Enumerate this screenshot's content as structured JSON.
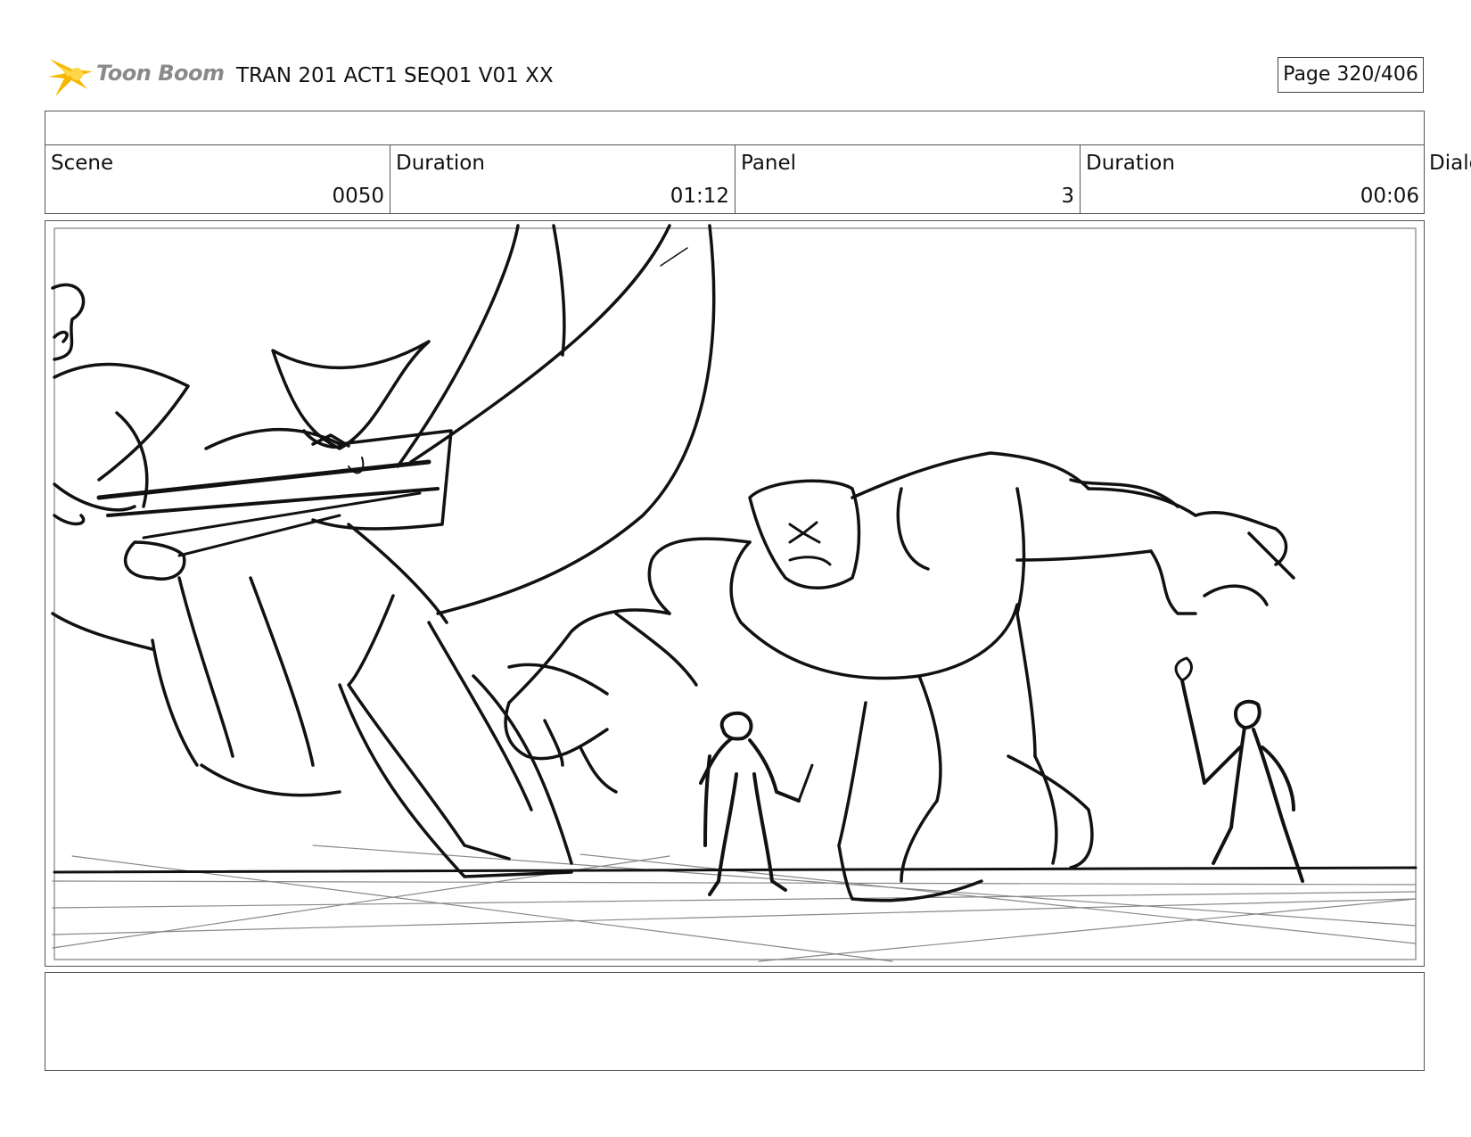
{
  "header": {
    "logo_text": "Toon Boom",
    "title": "TRAN 201 ACT1 SEQ01 V01 XX",
    "page": "Page 320/406"
  },
  "info": {
    "scene_label": "Scene",
    "scene_value": "0050",
    "scene_duration_label": "Duration",
    "scene_duration_value": "01:12",
    "panel_label": "Panel",
    "panel_value": "3",
    "panel_duration_label": "Duration",
    "panel_duration_value": "00:06",
    "dialog_label": "Dialo"
  },
  "colors": {
    "logo_yellow": "#f5b800",
    "logo_text": "#8a8a8a",
    "border": "#555555",
    "ink": "#111111"
  },
  "icons": [
    "toon-boom-star-icon"
  ]
}
